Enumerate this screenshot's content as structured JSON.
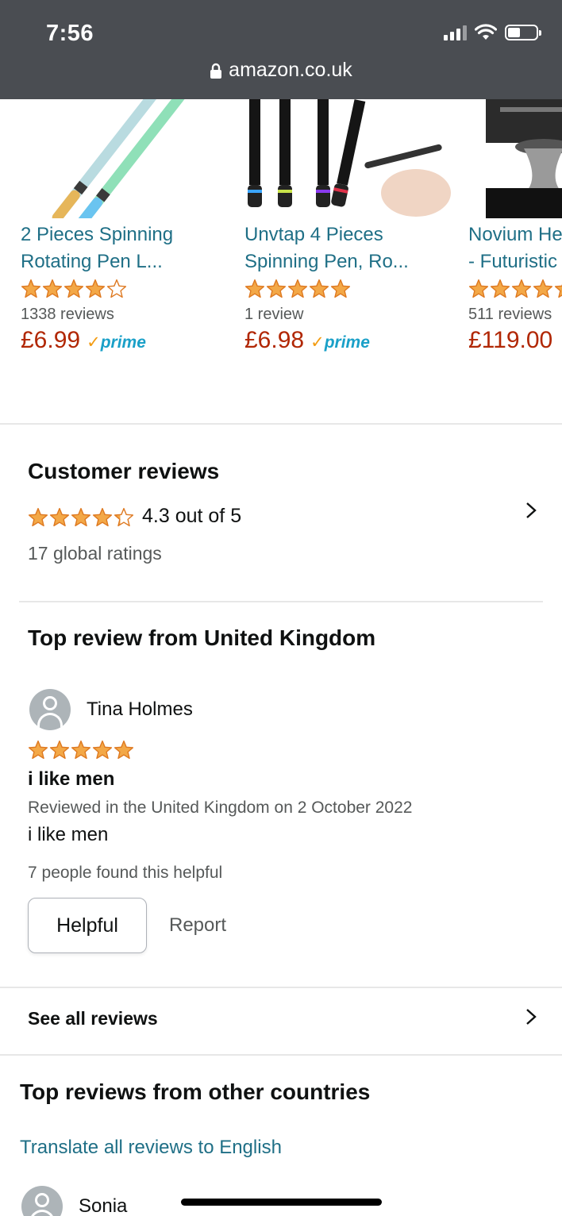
{
  "status_bar": {
    "time": "7:56",
    "url": "amazon.co.uk"
  },
  "products": [
    {
      "title": "2 Pieces Spinning\nRotating Pen L...",
      "rating": 4,
      "reviews": "1338 reviews",
      "price": "£6.99",
      "prime": "prime"
    },
    {
      "title": "Unvtap 4 Pieces\nSpinning Pen, Ro...",
      "rating": 5,
      "reviews": "1 review",
      "price": "£6.98",
      "prime": "prime"
    },
    {
      "title": "Novium He\n- Futuristic",
      "rating": 4.5,
      "reviews": "511 reviews",
      "price": "£119.00",
      "prime": ""
    }
  ],
  "customer_reviews": {
    "title": "Customer reviews",
    "average_rating": 4.3,
    "average_text": "4.3 out of 5",
    "global_ratings": "17 global ratings"
  },
  "top_review": {
    "section_title": "Top review from United Kingdom",
    "reviewer": "Tina Holmes",
    "rating": 5,
    "title": "i like men",
    "meta": "Reviewed in the United Kingdom on 2 October 2022",
    "body": "i like men",
    "helpful_count": "7 people found this helpful",
    "helpful_label": "Helpful",
    "report_label": "Report"
  },
  "see_all": "See all reviews",
  "other_countries": {
    "title": "Top reviews from other countries",
    "translate": "Translate all reviews to English",
    "first_reviewer": "Sonia"
  },
  "colors": {
    "star": "#f3a847",
    "link": "#1f6f86",
    "price": "#b12704",
    "statusbar": "#4a4d52"
  }
}
